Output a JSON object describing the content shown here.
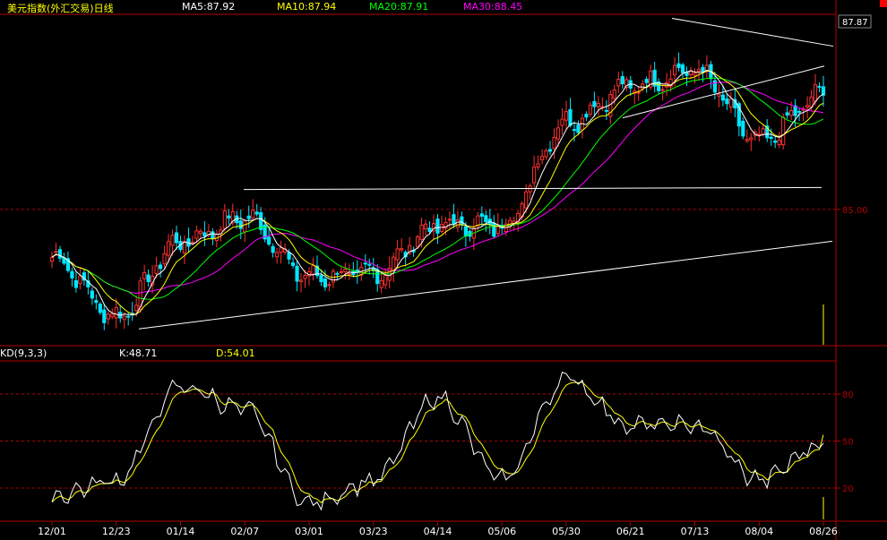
{
  "header": {
    "title": "美元指数(外汇交易)日线",
    "ma5": "MA5:87.92",
    "ma10": "MA10:87.94",
    "ma20": "MA20:87.91",
    "ma30": "MA30:88.45"
  },
  "kd_header": {
    "name": "KD(9,3,3)",
    "k": "K:48.71",
    "d": "D:54.01"
  },
  "price_axis": {
    "current_label": "87.87",
    "ref_label": "85.00"
  },
  "kd_axis": {
    "labels": [
      "80",
      "50",
      "20"
    ]
  },
  "x_axis": {
    "labels": [
      "12/01",
      "12/23",
      "01/14",
      "02/07",
      "03/01",
      "03/23",
      "04/14",
      "05/06",
      "05/30",
      "06/21",
      "07/13",
      "08/04",
      "08/26"
    ]
  },
  "colors": {
    "up": "#ff3030",
    "down": "#00e6ff",
    "ma5": "#ffffff",
    "ma10": "#ffff00",
    "ma20": "#00ff00",
    "ma30": "#ff00ff",
    "k_line": "#ffffff",
    "d_line": "#ffff00",
    "axis": "#b00000",
    "title": "#ffff00",
    "label": "#ffffff"
  },
  "chart_data": [
    {
      "type": "candlestick",
      "title": "美元指数(外汇交易)日线",
      "x_tick_labels": [
        "12/01",
        "12/23",
        "01/14",
        "02/07",
        "03/01",
        "03/23",
        "04/14",
        "05/06",
        "05/30",
        "06/21",
        "07/13",
        "08/04",
        "08/26"
      ],
      "y_tick_labels": [
        "85.00"
      ],
      "last_price": 87.87,
      "approx_close_path": [
        {
          "date": "12/01",
          "value": 83.8
        },
        {
          "date": "12/23",
          "value": 82.3
        },
        {
          "date": "01/14",
          "value": 84.2
        },
        {
          "date": "02/07",
          "value": 84.8
        },
        {
          "date": "03/01",
          "value": 83.3
        },
        {
          "date": "03/23",
          "value": 83.4
        },
        {
          "date": "04/14",
          "value": 84.6
        },
        {
          "date": "05/06",
          "value": 84.6
        },
        {
          "date": "05/30",
          "value": 87.2
        },
        {
          "date": "06/21",
          "value": 88.1
        },
        {
          "date": "07/13",
          "value": 88.5
        },
        {
          "date": "08/04",
          "value": 86.7
        },
        {
          "date": "08/26",
          "value": 87.87
        }
      ],
      "series": [
        {
          "name": "MA5",
          "value": 87.92
        },
        {
          "name": "MA10",
          "value": 87.94
        },
        {
          "name": "MA20",
          "value": 87.91
        },
        {
          "name": "MA30",
          "value": 88.45
        }
      ]
    },
    {
      "type": "line",
      "title": "KD(9,3,3)",
      "y_tick_labels": [
        "80",
        "50",
        "20"
      ],
      "ylim": [
        0,
        100
      ],
      "series": [
        {
          "name": "K",
          "value": 48.71
        },
        {
          "name": "D",
          "value": 54.01
        }
      ],
      "approx_k_path": [
        {
          "date": "12/01",
          "value": 15
        },
        {
          "date": "12/23",
          "value": 25
        },
        {
          "date": "01/14",
          "value": 85
        },
        {
          "date": "02/07",
          "value": 70
        },
        {
          "date": "03/01",
          "value": 10
        },
        {
          "date": "03/23",
          "value": 25
        },
        {
          "date": "04/14",
          "value": 78
        },
        {
          "date": "05/06",
          "value": 25
        },
        {
          "date": "05/30",
          "value": 90
        },
        {
          "date": "06/21",
          "value": 60
        },
        {
          "date": "07/13",
          "value": 60
        },
        {
          "date": "08/04",
          "value": 25
        },
        {
          "date": "08/26",
          "value": 48.71
        }
      ]
    }
  ]
}
